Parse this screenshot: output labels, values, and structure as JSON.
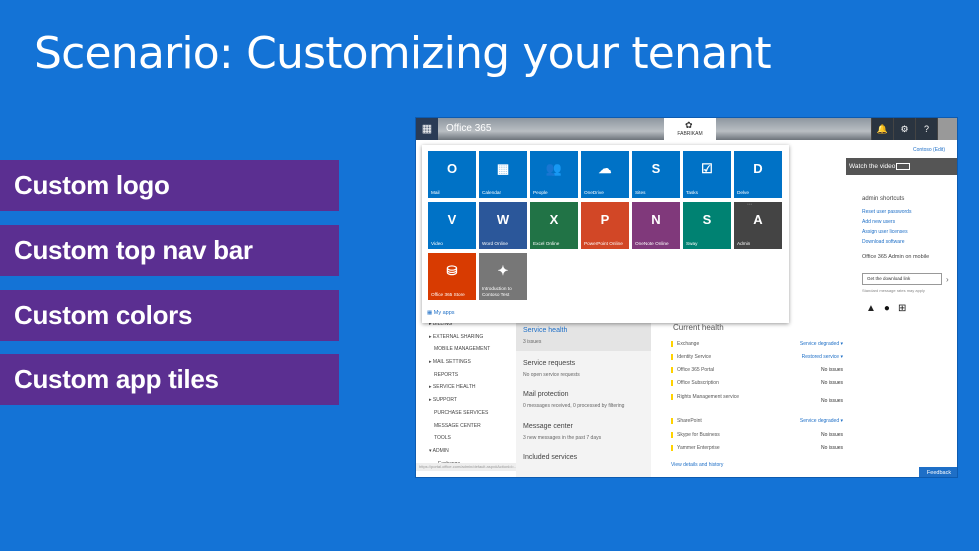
{
  "slide": {
    "title": "Scenario: Customizing your tenant",
    "features": [
      "Custom logo",
      "Custom top nav bar",
      "Custom colors",
      "Custom app tiles"
    ]
  },
  "colors": {
    "slide_background": "#1473d6",
    "feature_box": "#5b2f91",
    "accent_link": "#1e6fc7"
  },
  "topbar": {
    "app_title": "Office 365",
    "brand_logo_text": "FABRIKAM",
    "icons": [
      "waffle-icon",
      "bell-icon",
      "gear-icon",
      "help-icon"
    ],
    "help_glyph": "?"
  },
  "launcher": {
    "tiles": [
      {
        "label": "Mail",
        "glyph": "O",
        "color": "#0072c6",
        "icon": "mail-icon"
      },
      {
        "label": "Calendar",
        "glyph": "▦",
        "color": "#0072c6",
        "icon": "calendar-icon"
      },
      {
        "label": "People",
        "glyph": "👥",
        "color": "#0072c6",
        "icon": "people-icon"
      },
      {
        "label": "OneDrive",
        "glyph": "☁",
        "color": "#0072c6",
        "icon": "onedrive-icon"
      },
      {
        "label": "Sites",
        "glyph": "S",
        "color": "#0072c6",
        "icon": "sites-icon"
      },
      {
        "label": "Tasks",
        "glyph": "☑",
        "color": "#0072c6",
        "icon": "tasks-icon"
      },
      {
        "label": "Delve",
        "glyph": "D",
        "color": "#0072c6",
        "icon": "delve-icon"
      },
      {
        "label": "Video",
        "glyph": "V",
        "color": "#0072c6",
        "icon": "video-icon"
      },
      {
        "label": "Word Online",
        "glyph": "W",
        "color": "#2b579a",
        "icon": "word-icon"
      },
      {
        "label": "Excel Online",
        "glyph": "X",
        "color": "#217346",
        "icon": "excel-icon"
      },
      {
        "label": "PowerPoint Online",
        "glyph": "P",
        "color": "#d24726",
        "icon": "powerpoint-icon"
      },
      {
        "label": "OneNote Online",
        "glyph": "N",
        "color": "#80397b",
        "icon": "onenote-icon"
      },
      {
        "label": "Sway",
        "glyph": "S",
        "color": "#008272",
        "icon": "sway-icon"
      },
      {
        "label": "Admin",
        "glyph": "A",
        "color": "#444444",
        "icon": "admin-icon"
      },
      {
        "label": "Office 365 Store",
        "glyph": "⛁",
        "color": "#d83b01",
        "icon": "store-icon"
      },
      {
        "label": "Introduction to Contoso Test",
        "glyph": "✦",
        "color": "#777777",
        "icon": "custom-tile-icon"
      }
    ],
    "more_glyph": "•••",
    "my_apps": "My apps"
  },
  "sidenav": {
    "items": [
      "BILLING",
      "EXTERNAL SHARING",
      "MOBILE MANAGEMENT",
      "MAIL SETTINGS",
      "REPORTS",
      "SERVICE HEALTH",
      "SUPPORT",
      "PURCHASE SERVICES",
      "MESSAGE CENTER",
      "TOOLS",
      "ADMIN",
      "Exchange"
    ]
  },
  "status_url": "https://portal.office.com/admin/default.aspx#ActionId=...",
  "middle": {
    "service_health": "Service health",
    "service_health_sub": "3 issues",
    "service_requests": "Service requests",
    "service_requests_sub": "No open service requests",
    "mail_protection": "Mail protection",
    "mail_protection_sub": "0 messages received, 0 processed by filtering",
    "message_center": "Message center",
    "message_center_sub": "3 new messages in the past 7 days",
    "included_services": "Included services"
  },
  "health": {
    "title": "Current health",
    "rows": [
      {
        "service": "Exchange",
        "status": "Service degraded ▾",
        "link": true
      },
      {
        "service": "Identity Service",
        "status": "Restored service ▾",
        "link": true
      },
      {
        "service": "Office 365 Portal",
        "status": "No issues",
        "link": false
      },
      {
        "service": "Office Subscription",
        "status": "No issues",
        "link": false
      },
      {
        "service": "Rights Management service",
        "status": "No issues",
        "link": false
      },
      {
        "service": "SharePoint",
        "status": "Service degraded ▾",
        "link": true
      },
      {
        "service": "Skype for Business",
        "status": "No issues",
        "link": false
      },
      {
        "service": "Yammer Enterprise",
        "status": "No issues",
        "link": false
      }
    ],
    "view_details": "View details and history"
  },
  "right": {
    "learn_link": "Contoso (Edit)",
    "watch_video": "Watch the video",
    "admin_shortcuts": "admin shortcuts",
    "links": [
      "Reset user passwords",
      "Add new users",
      "Assign user licenses",
      "Download software"
    ],
    "mobile_title": "Office 365 Admin on mobile",
    "download_btn": "Get the download link",
    "download_note": "Standard message rates may apply",
    "download_arrow": "›",
    "feedback": "Feedback"
  }
}
